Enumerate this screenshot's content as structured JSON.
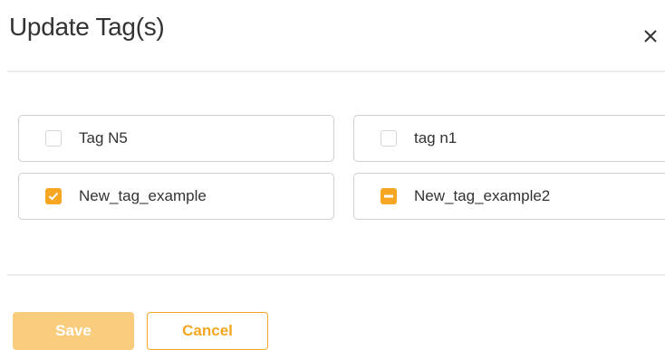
{
  "dialog": {
    "title": "Update Tag(s)",
    "close_icon": "close-icon"
  },
  "tags": [
    {
      "label": "Tag N5",
      "state": "unchecked"
    },
    {
      "label": "tag n1",
      "state": "unchecked"
    },
    {
      "label": "New_tag_example",
      "state": "checked"
    },
    {
      "label": "New_tag_example2",
      "state": "indeterminate"
    }
  ],
  "footer": {
    "save_label": "Save",
    "cancel_label": "Cancel"
  },
  "colors": {
    "accent": "#f5a623",
    "save_disabled_bg": "#f9cd7d"
  }
}
